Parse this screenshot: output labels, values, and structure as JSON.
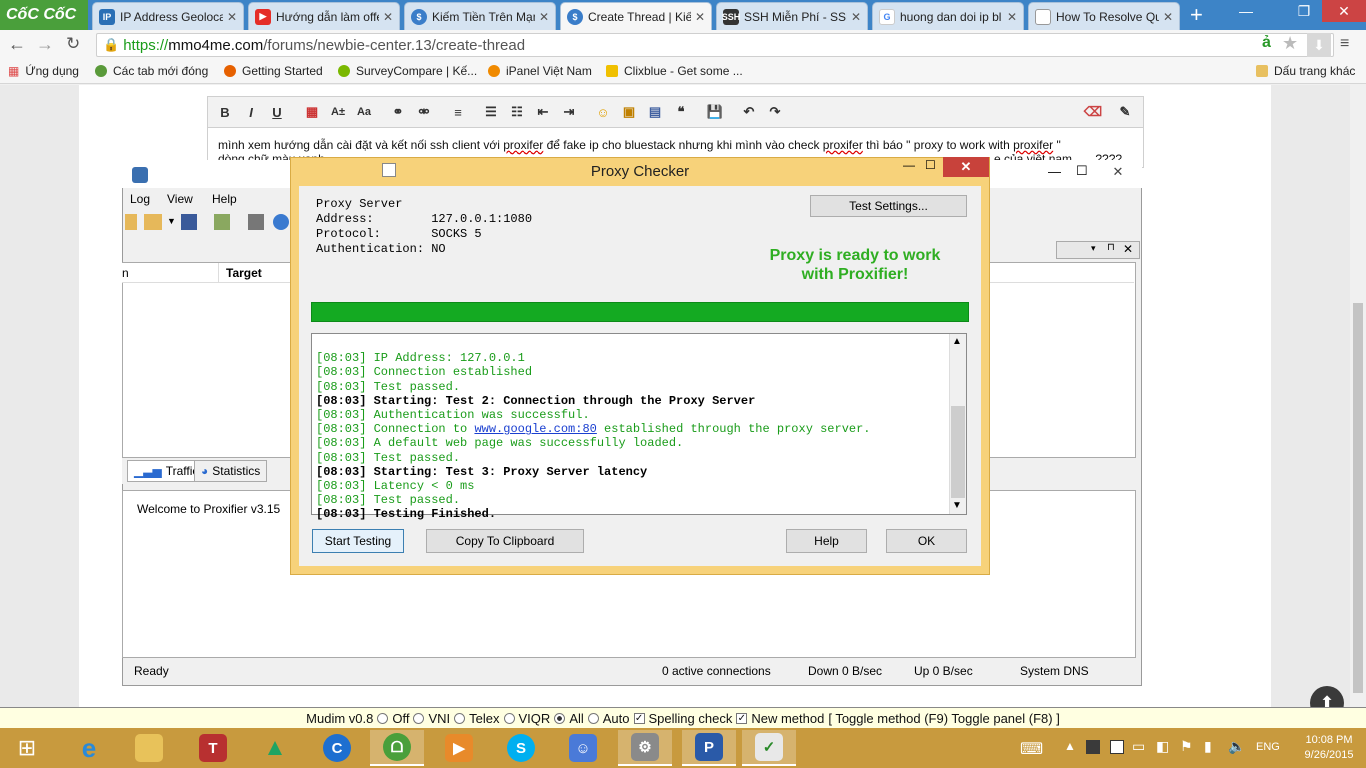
{
  "browser": {
    "logo": "CốC CốC",
    "tabs": [
      {
        "label": "IP Address Geolocat",
        "active": false
      },
      {
        "label": "Hướng dẫn làm offe",
        "active": false
      },
      {
        "label": "Kiếm Tiền Trên Mạn",
        "active": false
      },
      {
        "label": "Create Thread | Kiếm",
        "active": true
      },
      {
        "label": "SSH Miễn Phí - SSH",
        "active": false
      },
      {
        "label": "huong dan doi ip bl",
        "active": false
      },
      {
        "label": "How To Resolve Qu",
        "active": false
      }
    ],
    "url_prefix": "https://",
    "url_host": "mmo4me.com",
    "url_path": "/forums/newbie-center.13/create-thread",
    "bookmarks": [
      "Ứng dụng",
      "Các tab mới đóng",
      "Getting Started",
      "SurveyCompare | Kế...",
      "iPanel Việt Nam",
      "Clixblue - Get some ..."
    ],
    "other_bookmarks": "Dấu trang khác"
  },
  "editor": {
    "post_line1_a": "mình xem hướng dẫn cài đặt và kết nối ssh client với ",
    "post_line1_b": "proxifer",
    "post_line1_c": " để fake ip cho bluestack nhưng khi mình vào check  ",
    "post_line1_d": "proxifer",
    "post_line1_e": " thì báo \" proxy to work with ",
    "post_line1_f": "proxifer",
    "post_line1_g": " \"",
    "post_line2_a": "dòng chữ màu xanh",
    "post_line2_b": "e của việt nam ..... ????"
  },
  "proxifier": {
    "menu": [
      "Log",
      "View",
      "Help"
    ],
    "column_target": "Target",
    "tab_traffic": "Traffic",
    "tab_statistics": "Statistics",
    "welcome": "Welcome to Proxifier v3.15",
    "status_ready": "Ready",
    "status_connections": "0 active connections",
    "status_down": "Down 0 B/sec",
    "status_up": "Up 0 B/sec",
    "status_dns": "System DNS"
  },
  "checker": {
    "title": "Proxy Checker",
    "server_info": "Proxy Server\nAddress:        127.0.0.1:1080\nProtocol:       SOCKS 5\nAuthentication: NO",
    "test_settings": "Test Settings...",
    "ready_msg_1": "Proxy is ready to work",
    "ready_msg_2": "with Proxifier!",
    "progress_percent": 100,
    "log": [
      {
        "text": "[08:03] IP Address: 127.0.0.1",
        "style": "green"
      },
      {
        "text": "[08:03] Connection established",
        "style": "green"
      },
      {
        "text": "[08:03] Test passed.",
        "style": "green"
      },
      {
        "text": "[08:03] Starting: Test 2: Connection through the Proxy Server",
        "style": "bold"
      },
      {
        "text": "[08:03] Authentication was successful.",
        "style": "green"
      },
      {
        "text_a": "[08:03] Connection to ",
        "link": "www.google.com:80",
        "text_b": " established through the proxy server.",
        "style": "green-link"
      },
      {
        "text": "[08:03] A default web page was successfully loaded.",
        "style": "green"
      },
      {
        "text": "[08:03] Test passed.",
        "style": "green"
      },
      {
        "text": "[08:03] Starting: Test 3: Proxy Server latency",
        "style": "bold"
      },
      {
        "text": "[08:03] Latency < 0 ms",
        "style": "green"
      },
      {
        "text": "[08:03] Test passed.",
        "style": "green"
      },
      {
        "text": "[08:03] Testing Finished.",
        "style": "bold"
      }
    ],
    "btn_start": "Start Testing",
    "btn_copy": "Copy To Clipboard",
    "btn_help": "Help",
    "btn_ok": "OK"
  },
  "mudim": {
    "title": "Mudim v0.8",
    "off": "Off",
    "vni": "VNI",
    "telex": "Telex",
    "viqr": "VIQR",
    "all": "All",
    "auto": "Auto",
    "spelling": "Spelling check",
    "newmethod": "New method",
    "toggles": "[ Toggle method (F9) Toggle panel (F8) ]",
    "selected": "All"
  },
  "taskbar": {
    "lang": "ENG",
    "time": "10:08 PM",
    "date": "9/26/2015"
  },
  "colors": {
    "accent_green": "#2fae22",
    "progress_green": "#14aa22",
    "dialog_border": "#f7d27a",
    "taskbar": "#c89a3e",
    "tabbar": "#3d84c7"
  }
}
